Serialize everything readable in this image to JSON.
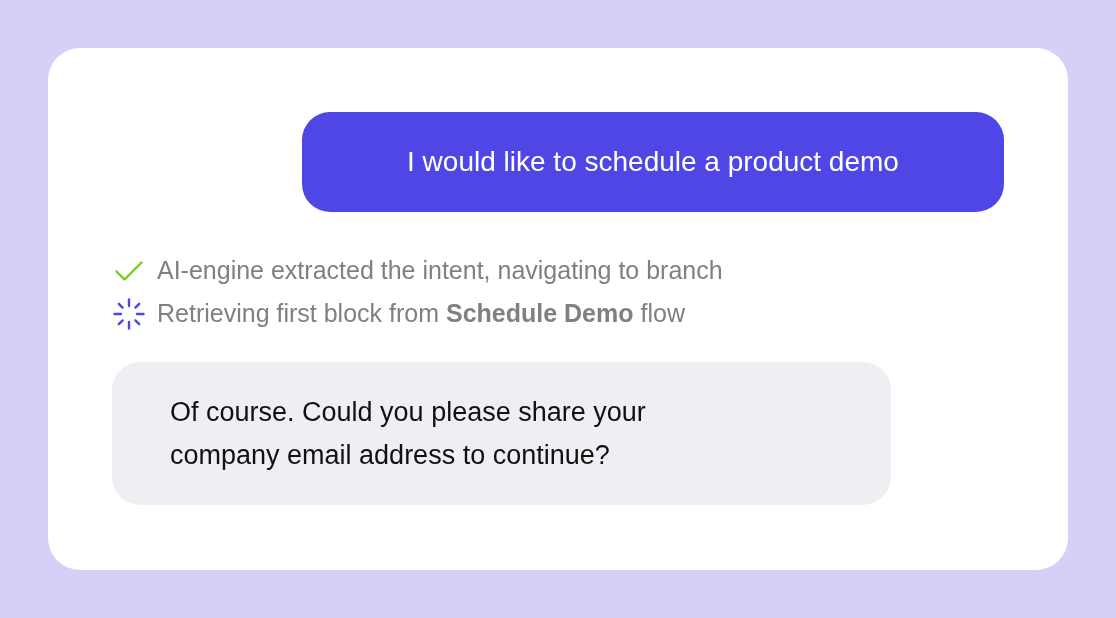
{
  "user_message": {
    "text": "I would like to schedule a product demo"
  },
  "status_steps": [
    {
      "kind": "done",
      "text": "AI-engine extracted the intent, navigating to branch"
    },
    {
      "kind": "loading",
      "text": "Retrieving first block from **Schedule Demo** flow"
    }
  ],
  "bot_message": {
    "text": "Of course. Could you please share your company email address to continue?"
  }
}
